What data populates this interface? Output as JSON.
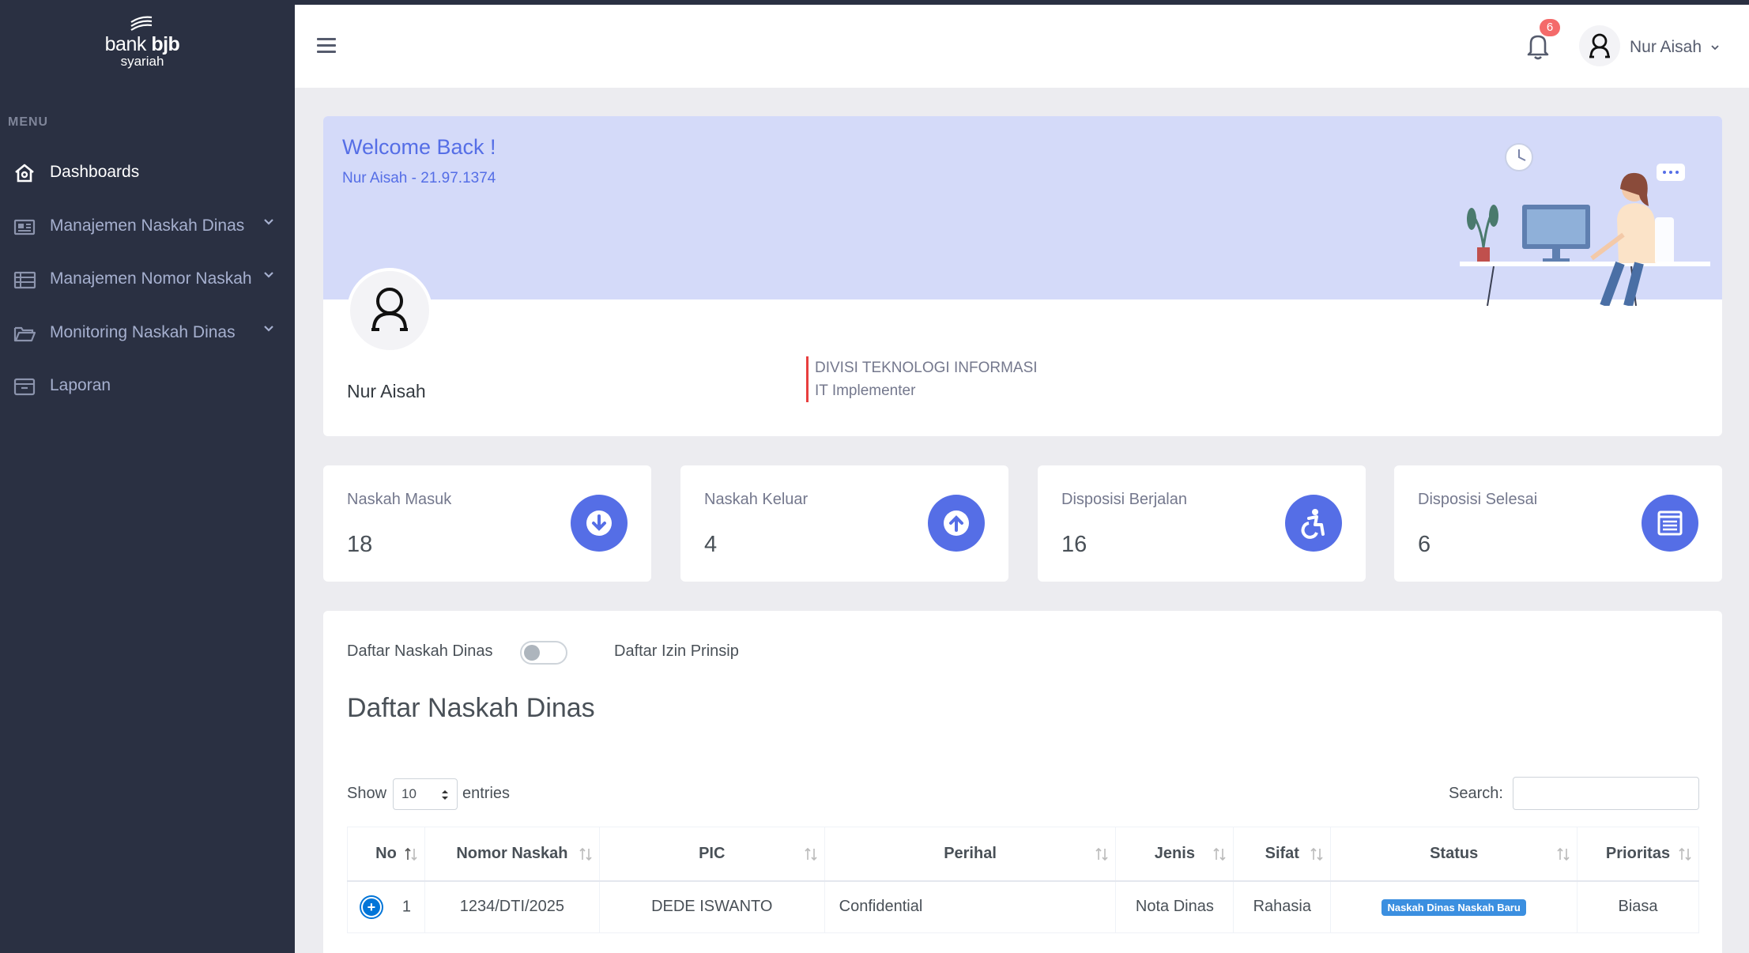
{
  "brand": {
    "name_light": "bank ",
    "name_bold": "bjb",
    "sub": "syariah"
  },
  "sidebar": {
    "menu_title": "MENU",
    "items": [
      {
        "label": "Dashboards",
        "icon": "home-icon"
      },
      {
        "label": "Manajemen Naskah Dinas",
        "icon": "newspaper-icon"
      },
      {
        "label": "Manajemen Nomor Naskah",
        "icon": "list-icon"
      },
      {
        "label": "Monitoring Naskah Dinas",
        "icon": "folder-open-icon"
      },
      {
        "label": "Laporan",
        "icon": "archive-icon"
      }
    ]
  },
  "header": {
    "notification_count": "6",
    "user_name": "Nur Aisah"
  },
  "welcome": {
    "title": "Welcome Back !",
    "subtitle": "Nur Aisah - 21.97.1374",
    "profile_name": "Nur Aisah",
    "division": "DIVISI TEKNOLOGI INFORMASI",
    "role": "IT Implementer"
  },
  "stats": [
    {
      "title": "Naskah Masuk",
      "value": "18",
      "icon": "arrow-down-circle-icon"
    },
    {
      "title": "Naskah Keluar",
      "value": "4",
      "icon": "arrow-up-circle-icon"
    },
    {
      "title": "Disposisi Berjalan",
      "value": "16",
      "icon": "accessible-icon"
    },
    {
      "title": "Disposisi Selesai",
      "value": "6",
      "icon": "clipboard-list-icon"
    }
  ],
  "list": {
    "toggle_left": "Daftar Naskah Dinas",
    "toggle_right": "Daftar Izin Prinsip",
    "title": "Daftar Naskah Dinas",
    "show_label": "Show",
    "page_size": "10",
    "entries_label": "entries",
    "search_label": "Search:",
    "columns": [
      "No",
      "Nomor Naskah",
      "PIC",
      "Perihal",
      "Jenis",
      "Sifat",
      "Status",
      "Prioritas"
    ],
    "rows": [
      {
        "no": "1",
        "nomor": "1234/DTI/2025",
        "pic": "DEDE ISWANTO",
        "perihal": "Confidential",
        "jenis": "Nota Dinas",
        "sifat": "Rahasia",
        "status": "Naskah Dinas Naskah Baru",
        "prioritas": "Biasa"
      }
    ]
  },
  "colors": {
    "sidebar": "#2a3042",
    "primary": "#556ee6",
    "welcome_band": "#d4daf9",
    "badge": "#f46a6a"
  }
}
